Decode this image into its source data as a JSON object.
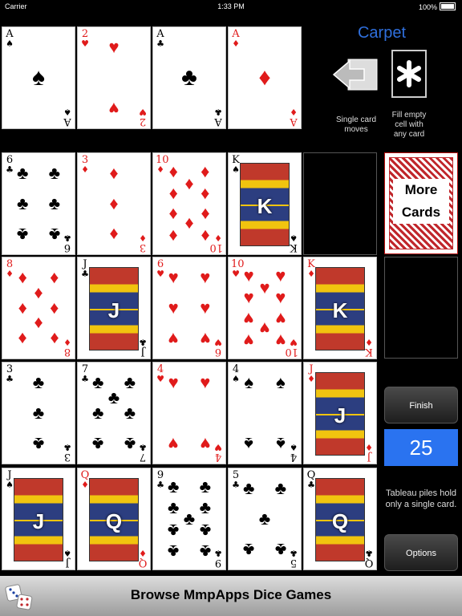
{
  "status_bar": {
    "carrier": "Carrier",
    "time": "1:33 PM",
    "battery": "100%"
  },
  "game_title": "Carpet",
  "mode_buttons": [
    {
      "icon": "arrow-left-icon",
      "caption_line1": "Single card",
      "caption_line2": "moves"
    },
    {
      "icon": "asterisk-icon",
      "caption_line1": "Fill empty",
      "caption_line2": "cell with",
      "caption_line3": "any card"
    }
  ],
  "foundations": [
    {
      "rank": "A",
      "suit": "♠",
      "color": "black"
    },
    {
      "rank": "2",
      "suit": "♥",
      "color": "red"
    },
    {
      "rank": "A",
      "suit": "♣",
      "color": "black"
    },
    {
      "rank": "A",
      "suit": "♦",
      "color": "red"
    }
  ],
  "tableau": [
    [
      {
        "rank": "6",
        "suit": "♣",
        "color": "black"
      },
      {
        "rank": "3",
        "suit": "♦",
        "color": "red"
      },
      {
        "rank": "10",
        "suit": "♦",
        "color": "red"
      },
      {
        "rank": "K",
        "suit": "♠",
        "color": "black"
      },
      {
        "empty": true
      }
    ],
    [
      {
        "rank": "8",
        "suit": "♦",
        "color": "red"
      },
      {
        "rank": "J",
        "suit": "♣",
        "color": "black"
      },
      {
        "rank": "6",
        "suit": "♥",
        "color": "red"
      },
      {
        "rank": "10",
        "suit": "♥",
        "color": "red"
      },
      {
        "rank": "K",
        "suit": "♦",
        "color": "red"
      }
    ],
    [
      {
        "rank": "3",
        "suit": "♣",
        "color": "black"
      },
      {
        "rank": "7",
        "suit": "♣",
        "color": "black"
      },
      {
        "rank": "4",
        "suit": "♥",
        "color": "red"
      },
      {
        "rank": "4",
        "suit": "♠",
        "color": "black"
      },
      {
        "rank": "J",
        "suit": "♦",
        "color": "red"
      }
    ],
    [
      {
        "rank": "J",
        "suit": "♠",
        "color": "black"
      },
      {
        "rank": "Q",
        "suit": "♦",
        "color": "red"
      },
      {
        "rank": "9",
        "suit": "♣",
        "color": "black"
      },
      {
        "rank": "5",
        "suit": "♣",
        "color": "black"
      },
      {
        "rank": "Q",
        "suit": "♣",
        "color": "black"
      }
    ]
  ],
  "stock_button": {
    "line1": "More",
    "line2": "Cards"
  },
  "finish_button": "Finish",
  "cards_left": "25",
  "hint": "Tableau piles hold only a single card.",
  "options_button": "Options",
  "banner": {
    "text": "Browse MmpApps Dice Games"
  }
}
